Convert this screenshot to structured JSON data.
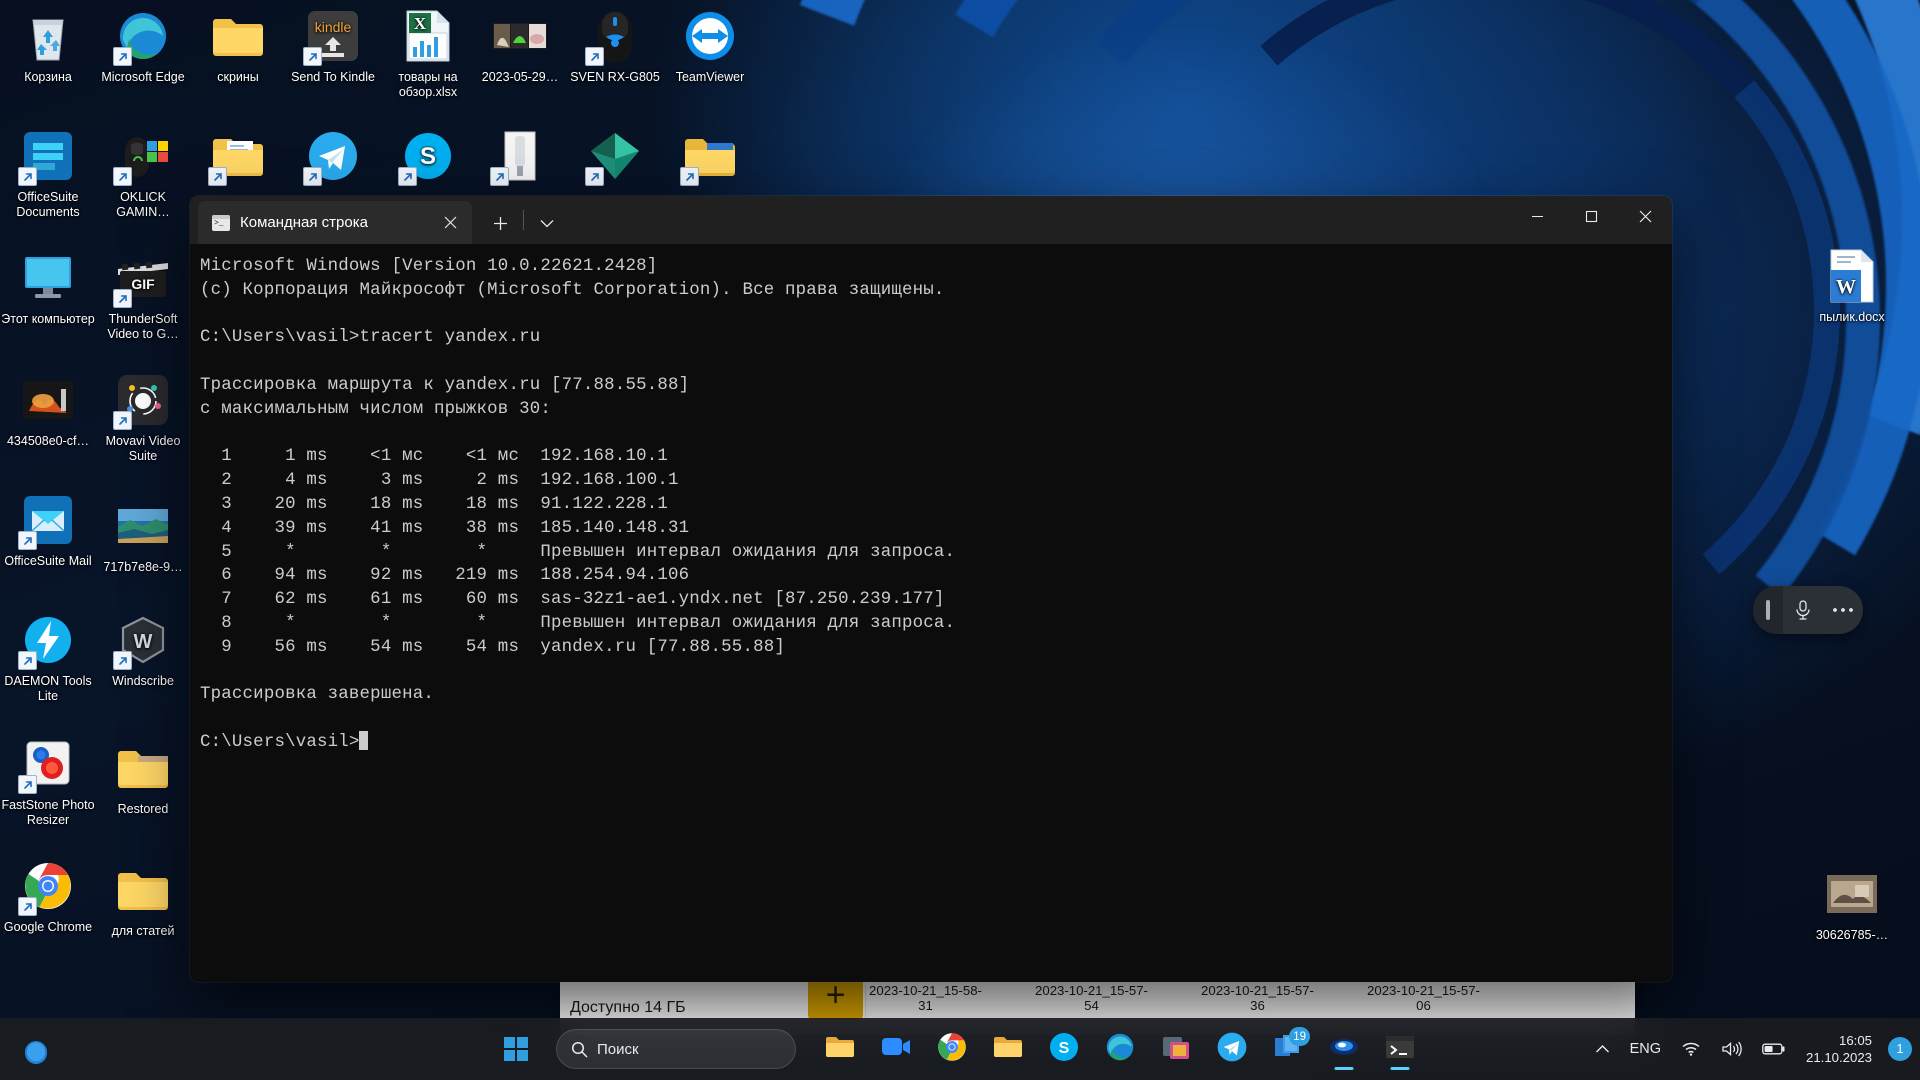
{
  "desktop": {
    "left_icons": [
      {
        "label": "Корзина",
        "icon": "recycle-bin-icon",
        "shortcut": false
      },
      {
        "label": "Microsoft Edge",
        "icon": "edge-icon",
        "shortcut": true
      },
      {
        "label": "OfficeSuite Documents",
        "icon": "officesuite-documents-icon",
        "shortcut": true
      },
      {
        "label": "OKLICK GAMIN...",
        "icon": "oklick-gaming-icon",
        "shortcut": true
      },
      {
        "label": "Этот компьютер",
        "icon": "this-pc-icon",
        "shortcut": false
      },
      {
        "label": "ThunderSoft Video to G...",
        "icon": "thundersoft-gif-icon",
        "shortcut": true
      },
      {
        "label": "434508e0-cf...",
        "icon": "image-thumbnail-icon",
        "shortcut": false
      },
      {
        "label": "Movavi Video Suite",
        "icon": "movavi-icon",
        "shortcut": true
      },
      {
        "label": "OfficeSuite Mail",
        "icon": "officesuite-mail-icon",
        "shortcut": true
      },
      {
        "label": "717b7e8e-9...",
        "icon": "landscape-thumbnail-icon",
        "shortcut": false
      },
      {
        "label": "DAEMON Tools Lite",
        "icon": "daemon-tools-icon",
        "shortcut": true
      },
      {
        "label": "Windscribe",
        "icon": "windscribe-icon",
        "shortcut": true
      },
      {
        "label": "FastStone Photo Resizer",
        "icon": "faststone-icon",
        "shortcut": true
      },
      {
        "label": "Restored",
        "icon": "folder-icon",
        "shortcut": false
      },
      {
        "label": "Google Chrome",
        "icon": "chrome-icon",
        "shortcut": true
      },
      {
        "label": "для статей",
        "icon": "folder-icon",
        "shortcut": false
      },
      {
        "label": "скрины",
        "icon": "folder-icon",
        "shortcut": false
      },
      {
        "label": "Send To Kindle",
        "icon": "kindle-icon",
        "shortcut": true
      },
      {
        "label": "товары на обзор.xlsx",
        "icon": "excel-icon",
        "shortcut": false
      },
      {
        "label": "2023-05-29...",
        "icon": "photo-strip-icon",
        "shortcut": false
      },
      {
        "label": "SVEN RX-G805",
        "icon": "mouse-icon",
        "shortcut": true
      },
      {
        "label": "TeamViewer",
        "icon": "teamviewer-icon",
        "shortcut": false
      },
      {
        "label": "",
        "icon": "folder-icon",
        "shortcut": true
      },
      {
        "label": "",
        "icon": "telegram-icon",
        "shortcut": true
      },
      {
        "label": "",
        "icon": "skype-icon",
        "shortcut": true
      },
      {
        "label": "",
        "icon": "device-icon",
        "shortcut": true
      },
      {
        "label": "",
        "icon": "gem-icon",
        "shortcut": true
      },
      {
        "label": "",
        "icon": "folder-blue-icon",
        "shortcut": true
      }
    ],
    "right_icons": [
      {
        "label": "пылик.docx",
        "icon": "word-document-icon",
        "shortcut": false
      },
      {
        "label": "30626785-...",
        "icon": "image-thumbnail-icon",
        "shortcut": false
      }
    ]
  },
  "console": {
    "tab_title": "Командная строка",
    "new_tab_label": "+",
    "dropdown_label": "⌄",
    "close_tab_label": "✕",
    "minimize_label": "—",
    "maximize_label": "▢",
    "close_label": "✕",
    "output": "Microsoft Windows [Version 10.0.22621.2428]\n(c) Корпорация Майкрософт (Microsoft Corporation). Все права защищены.\n\nC:\\Users\\vasil>tracert yandex.ru\n\nТрассировка маршрута к yandex.ru [77.88.55.88]\nс максимальным числом прыжков 30:\n\n  1     1 ms    <1 мс    <1 мс  192.168.10.1\n  2     4 ms     3 ms     2 ms  192.168.100.1\n  3    20 ms    18 ms    18 ms  91.122.228.1\n  4    39 ms    41 ms    38 ms  185.140.148.31\n  5     *        *        *     Превышен интервал ожидания для запроса.\n  6    94 ms    92 ms   219 ms  188.254.94.106\n  7    62 ms    61 ms    60 ms  sas-32z1-ae1.yndx.net [87.250.239.177]\n  8     *        *        *     Превышен интервал ожидания для запроса.\n  9    56 ms    54 ms    54 ms  yandex.ru [77.88.55.88]\n\nТрассировка завершена.\n\nC:\\Users\\vasil>",
    "prompt": "C:\\Users\\vasil>"
  },
  "background_window": {
    "available_text": "Доступно 14 ГБ",
    "add_button": "+",
    "thumbnails": [
      "2023-10-21_15-58-31",
      "2023-10-21_15-57-54",
      "2023-10-21_15-57-36",
      "2023-10-21_15-57-06"
    ]
  },
  "mic_toolbar": {
    "grip": "drag-handle-icon",
    "mic": "microphone-icon",
    "more": "more-options-icon"
  },
  "taskbar": {
    "search_placeholder": "Поиск",
    "start_label": "start-icon",
    "items": [
      {
        "name": "copilot-icon",
        "active": false
      },
      {
        "name": "file-explorer-icon",
        "active": false
      },
      {
        "name": "zoom-icon",
        "active": false
      },
      {
        "name": "chrome-icon",
        "active": false
      },
      {
        "name": "folder-icon",
        "active": false
      },
      {
        "name": "skype-icon",
        "active": false
      },
      {
        "name": "edge-icon",
        "active": false
      },
      {
        "name": "screenshot-tool-icon",
        "active": false
      },
      {
        "name": "telegram-icon",
        "active": false
      },
      {
        "name": "store-icon",
        "active": false,
        "badge": "19"
      },
      {
        "name": "movavi-icon",
        "active": true
      },
      {
        "name": "command-prompt-icon",
        "active": true
      }
    ],
    "tray": {
      "chevron": "show-hidden-icons",
      "language": "ENG",
      "wifi": "wifi-icon",
      "volume": "volume-icon",
      "battery": "battery-icon"
    },
    "clock_time": "16:05",
    "clock_date": "21.10.2023",
    "notification_count": "1"
  },
  "colors": {
    "accent": "#60cdff",
    "console_bg": "#0c0c0c",
    "console_fg": "#cccccc",
    "titlebar": "#202020",
    "taskbar": "#1a1c20"
  }
}
